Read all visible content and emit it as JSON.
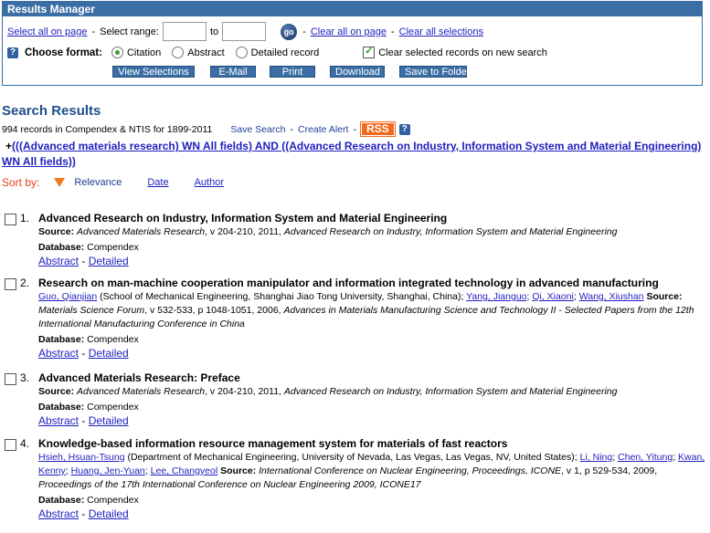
{
  "results_manager": {
    "title": "Results Manager",
    "select_all": "Select all on page",
    "select_range": "Select range:",
    "to": "to",
    "go": "go",
    "clear_all_page": "Clear all on page",
    "clear_all_sel": "Clear all selections",
    "choose_format": "Choose format:",
    "formats": [
      "Citation",
      "Abstract",
      "Detailed record"
    ],
    "selected_format": "Citation",
    "clear_on_new": "Clear selected records on new search",
    "clear_on_new_checked": true,
    "buttons": [
      "View Selections",
      "E-Mail",
      "Print",
      "Download",
      "Save to Folder"
    ]
  },
  "search": {
    "title": "Search Results",
    "summary": "994 records in Compendex & NTIS for 1899-2011",
    "save_search": "Save Search",
    "create_alert": "Create Alert",
    "rss": "RSS",
    "query_prefix": "+",
    "query": "(((Advanced materials research) WN All fields) AND ((Advanced Research on Industry, Information System and Material Engineering) WN All fields))",
    "sort_by": "Sort by:",
    "sort_options": [
      "Relevance",
      "Date",
      "Author"
    ]
  },
  "results": [
    {
      "num": "1.",
      "title": "Advanced Research on Industry, Information System and Material Engineering",
      "authors_html": "",
      "source": "<b>Source:</b> <i>Advanced Materials Research</i>, v 204-210, 2011, <i>Advanced Research on Industry, Information System and Material Engineering</i>",
      "db_label": "Database:",
      "db": "Compendex",
      "abstract": "Abstract",
      "detailed": "Detailed"
    },
    {
      "num": "2.",
      "title": "Research on man-machine cooperation manipulator and information integrated technology in advanced manufacturing",
      "source": "<a>Guo, Qianjian</a> (School of Mechanical Engineering, Shanghai Jiao Tong University, Shanghai, China); <a>Yang, Jianguo</a>; <a>Qi, Xiaoni</a>; <a>Wang, Xiushan</a> <b>Source:</b> <i>Materials Science Forum</i>, v 532-533, p 1048-1051, 2006, <i>Advances in Materials Manufacturing Science and Technology II - Selected Papers from the 12th International Manufacturing Conference in China</i>",
      "db_label": "Database:",
      "db": "Compendex",
      "abstract": "Abstract",
      "detailed": "Detailed"
    },
    {
      "num": "3.",
      "title": "Advanced Materials Research: Preface",
      "source": "<b>Source:</b> <i>Advanced Materials Research</i>, v 204-210, 2011, <i>Advanced Research on Industry, Information System and Material Engineering</i>",
      "db_label": "Database:",
      "db": "Compendex",
      "abstract": "Abstract",
      "detailed": "Detailed"
    },
    {
      "num": "4.",
      "title": "Knowledge-based information resource management system for materials of fast reactors",
      "source": "<a>Hsieh, Hsuan-Tsung</a> (Department of Mechanical Engineering, University of Nevada, Las Vegas, Las Vegas, NV, United States); <a>Li, Ning</a>; <a>Chen, Yitung</a>; <a>Kwan, Kenny</a>; <a>Huang, Jen-Yuan</a>; <a>Lee, Changyeol</a> <b>Source:</b> <i>International Conference on Nuclear Engineering, Proceedings, ICONE</i>, v 1, p 529-534, 2009, <i>Proceedings of the 17th International Conference on Nuclear Engineering 2009, ICONE17</i>",
      "db_label": "Database:",
      "db": "Compendex",
      "abstract": "Abstract",
      "detailed": "Detailed"
    }
  ]
}
